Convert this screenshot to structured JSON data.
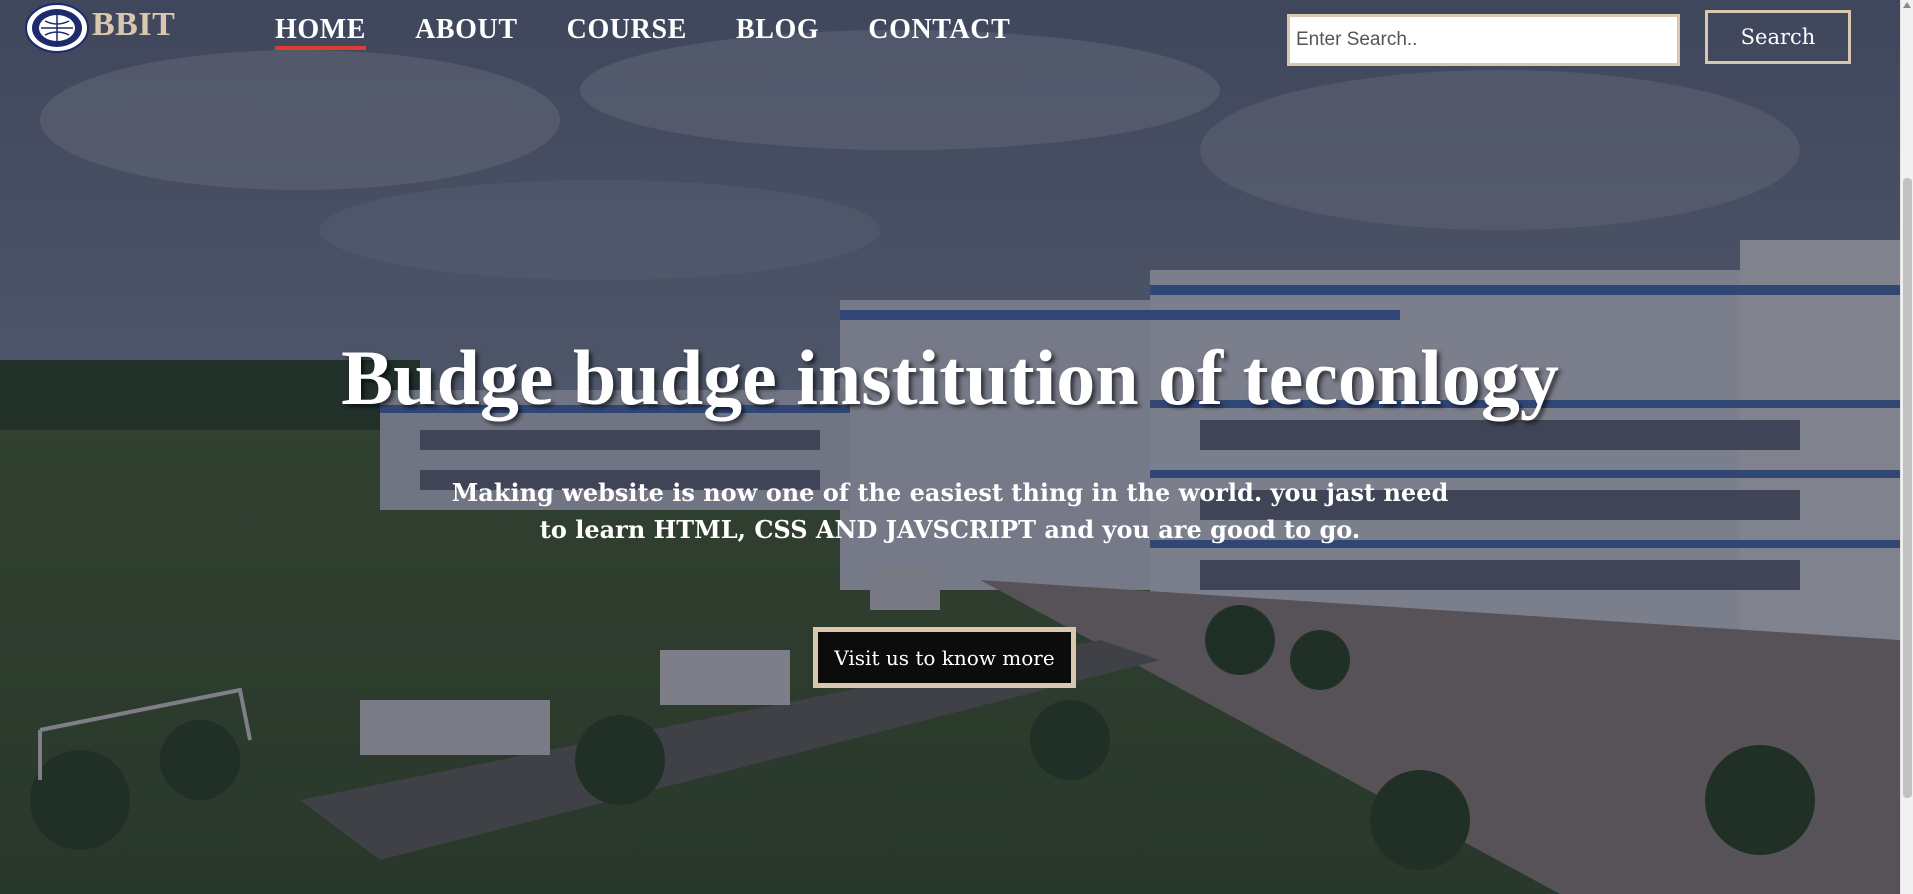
{
  "brand": {
    "name": "BBIT",
    "logo_icon": "college-emblem-icon"
  },
  "nav": {
    "items": [
      {
        "label": "HOME",
        "active": true
      },
      {
        "label": "ABOUT",
        "active": false
      },
      {
        "label": "COURSE",
        "active": false
      },
      {
        "label": "BLOG",
        "active": false
      },
      {
        "label": "CONTACT",
        "active": false
      }
    ]
  },
  "search": {
    "placeholder": "Enter Search..",
    "value": "",
    "button_label": "Search"
  },
  "hero": {
    "title": "Budge budge institution of teconlogy",
    "subtitle": "Making website is now one of the easiest thing in the world. you jast need to learn HTML, CSS AND JAVSCRIPT and you are good to go.",
    "cta_label": "Visit us to know more"
  },
  "colors": {
    "accent": "#d9c8ad",
    "active_underline": "#e23b2f",
    "cta_background": "#0c0c0c"
  }
}
